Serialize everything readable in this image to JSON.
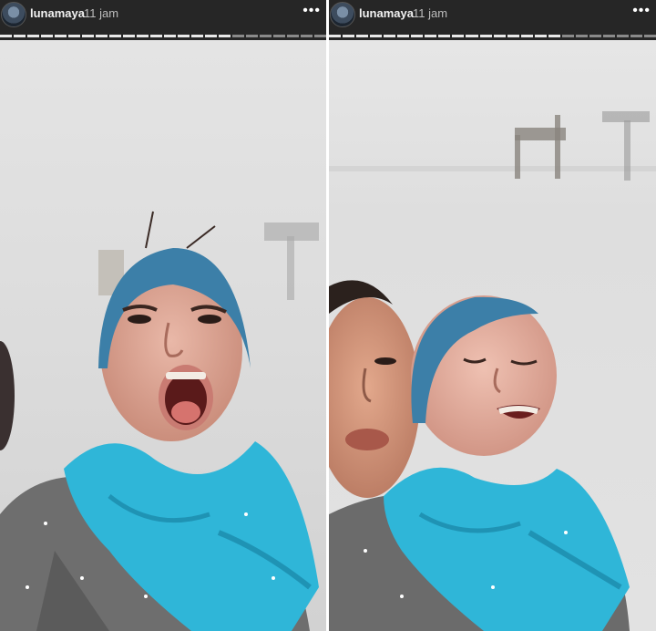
{
  "stories": [
    {
      "username": "lunamaya",
      "time_ago": "11 jam",
      "more_icon": "more-icon",
      "segments_total": 24,
      "segments_viewed": 17
    },
    {
      "username": "lunamaya",
      "time_ago": "11 jam",
      "more_icon": "more-icon",
      "segments_total": 24,
      "segments_viewed": 17
    }
  ],
  "colors": {
    "header": "#262626",
    "scarf": "#2fb6d8",
    "coat": "#6b6b6b",
    "snow": "#dedede"
  }
}
